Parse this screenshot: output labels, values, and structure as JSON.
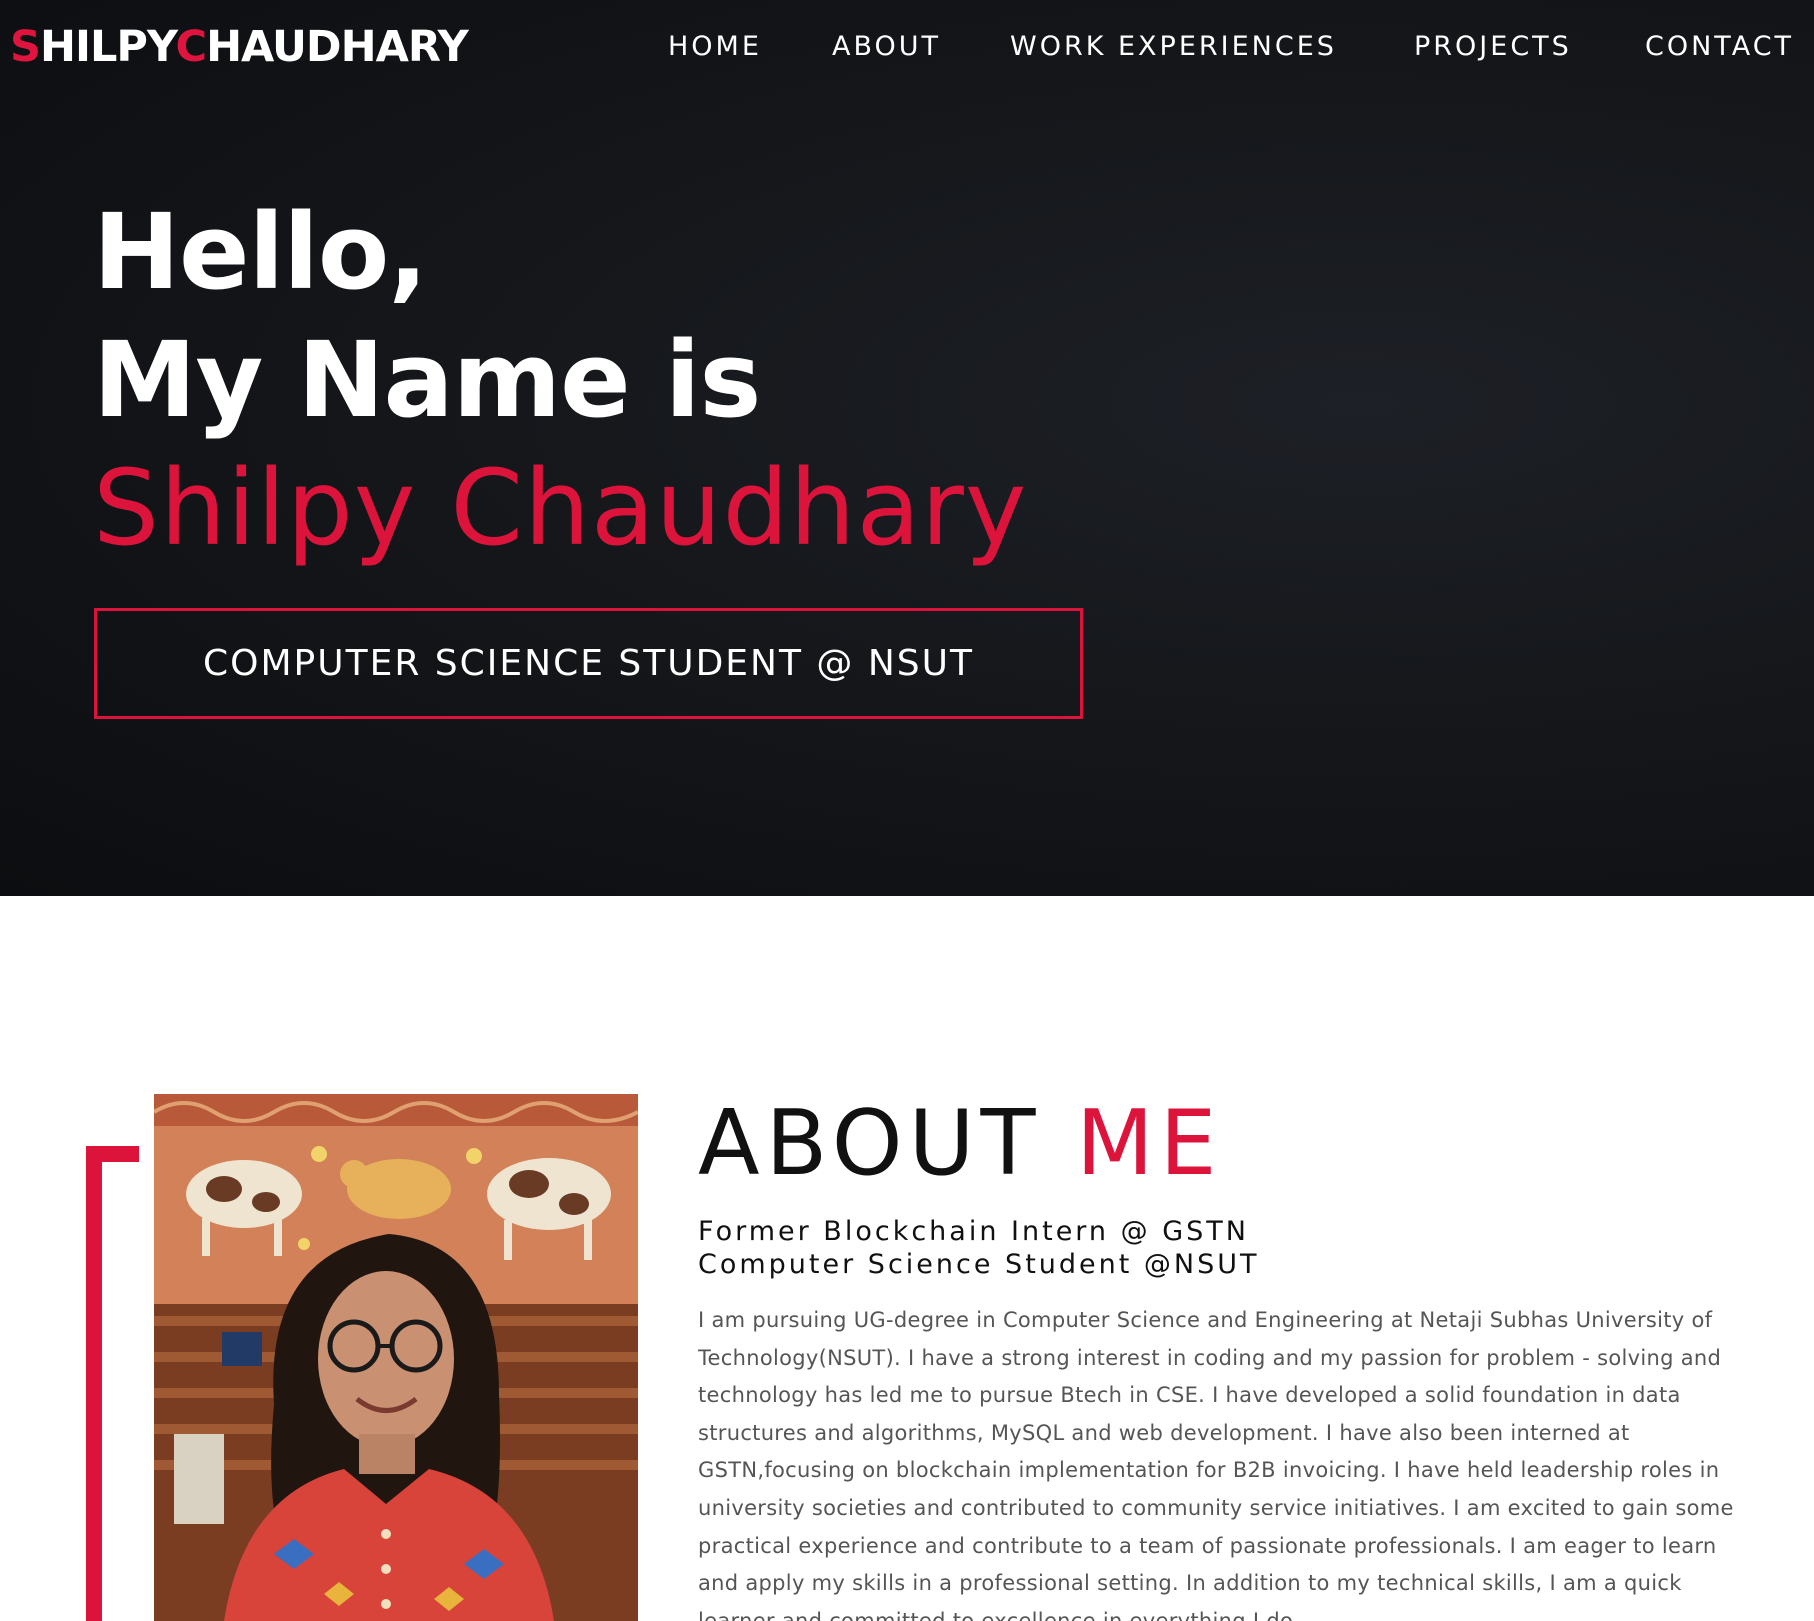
{
  "header": {
    "logo_first_initial": "S",
    "logo_first_rest": "HILPY",
    "logo_last_initial": "C",
    "logo_last_rest": "HAUDHARY",
    "nav": {
      "home": "HOME",
      "about": "ABOUT",
      "work": "WORK EXPERIENCES",
      "projects": "PROJECTS",
      "contact": "CONTACT"
    }
  },
  "hero": {
    "line1": "Hello,",
    "line2": "My Name is",
    "name": "Shilpy Chaudhary",
    "tagline": "COMPUTER SCIENCE STUDENT @ NSUT"
  },
  "about": {
    "title_part1": "ABOUT",
    "title_part2": "ME",
    "subtitle1": "Former Blockchain Intern @ GSTN",
    "subtitle2": "Computer Science Student @NSUT",
    "bio": "I am pursuing UG-degree in Computer Science and Engineering at Netaji Subhas University of Technology(NSUT). I have a strong interest in coding and my passion for problem - solving and technology has led me to pursue Btech in CSE. I have developed a solid foundation in data structures and algorithms, MySQL and web development. I have also been interned at GSTN,focusing on blockchain implementation for B2B invoicing. I have held leadership roles in university societies and contributed to community service initiatives. I am excited to gain some practical experience and contribute to a team of passionate professionals. I am eager to learn and apply my skills in a professional setting. In addition to my technical skills, I am a quick learner and committed to excellence in everything I do."
  },
  "colors": {
    "accent": "#dc143c",
    "hero_bg": "#121418",
    "text_light": "#ffffff",
    "text_dark": "#111111",
    "text_muted": "#555555"
  }
}
